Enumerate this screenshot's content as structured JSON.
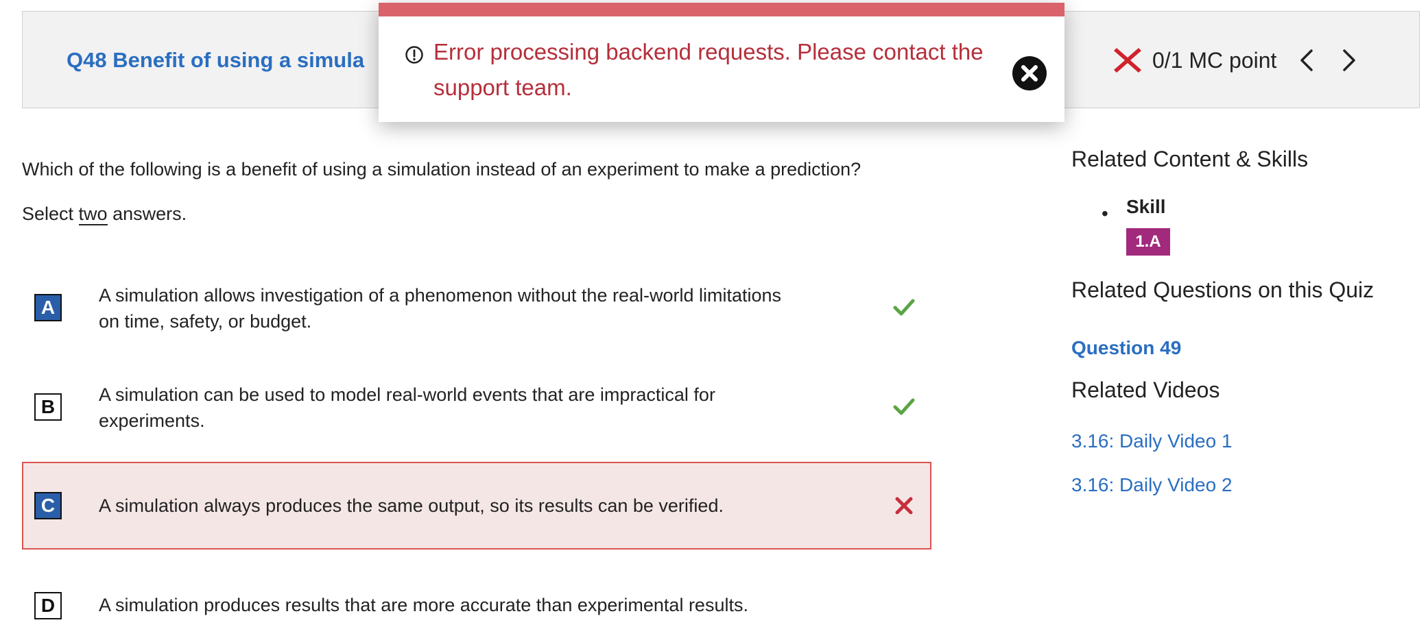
{
  "header": {
    "question_title": "Q48 Benefit of using a simula",
    "score_text": "0/1 MC point",
    "status": "incorrect",
    "colors": {
      "title": "#2a6ec1",
      "wrong": "#d0232d"
    }
  },
  "toast": {
    "message": "Error processing backend requests. Please contact the support team.",
    "colors": {
      "bar": "#d9626b",
      "text": "#b52e3a"
    },
    "icon": "alert-circle-icon",
    "close_icon": "close-circle-icon"
  },
  "question": {
    "prompt": "Which of the following is a benefit of using a simulation instead of an experiment to make a prediction?",
    "instruction_pre": "Select ",
    "instruction_emph": "two",
    "instruction_post": " answers."
  },
  "choices": [
    {
      "letter": "A",
      "text": "A simulation allows investigation of a phenomenon without the real-world limitations on time, safety, or budget.",
      "selected": true,
      "result": "correct"
    },
    {
      "letter": "B",
      "text": "A simulation can be used to model real-world events that are impractical for experiments.",
      "selected": false,
      "result": "correct"
    },
    {
      "letter": "C",
      "text": "A simulation always produces the same output, so its results can be verified.",
      "selected": true,
      "result": "incorrect"
    },
    {
      "letter": "D",
      "text": "A simulation produces results that are more accurate than experimental results.",
      "selected": false,
      "result": "none"
    }
  ],
  "sidebar": {
    "related_content_heading": "Related Content & Skills",
    "skill_label": "Skill",
    "skill_badge": "1.A",
    "related_questions_heading": "Related Questions on this Quiz",
    "related_question_link": "Question 49",
    "related_videos_heading": "Related Videos",
    "videos": [
      "3.16: Daily Video 1",
      "3.16: Daily Video 2"
    ],
    "colors": {
      "link": "#2a6ec1",
      "badge": "#a12a7d"
    }
  }
}
